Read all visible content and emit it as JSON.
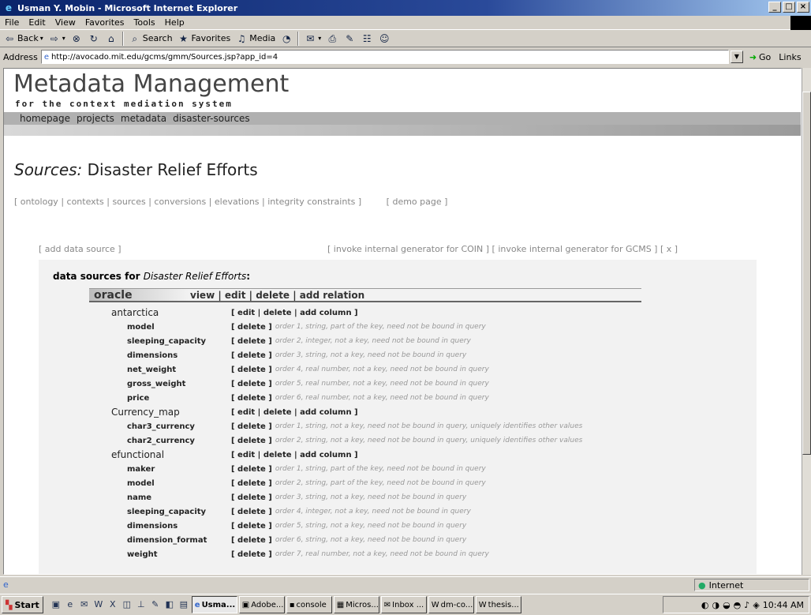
{
  "window": {
    "title": "Usman Y. Mobin - Microsoft Internet Explorer",
    "buttons": [
      "_",
      "×"
    ]
  },
  "menu": [
    "File",
    "Edit",
    "View",
    "Favorites",
    "Tools",
    "Help"
  ],
  "toolbar": {
    "back": "Back",
    "search": "Search",
    "favorites": "Favorites",
    "media": "Media"
  },
  "address": {
    "label": "Address",
    "url": "http://avocado.mit.edu/gcms/gmm/Sources.jsp?app_id=4",
    "go": "Go",
    "links": "Links"
  },
  "site": {
    "logo": "Metadata Management",
    "tagline": "for the context mediation system",
    "nav": [
      "homepage",
      "projects",
      "metadata",
      "disaster-sources"
    ]
  },
  "page": {
    "title_italic": "Sources:",
    "title_rest": "Disaster Relief Efforts",
    "crumbs": [
      "ontology",
      "contexts",
      "sources",
      "conversions",
      "elevations",
      "integrity constraints"
    ],
    "demo": "demo page",
    "add_source": "add data source",
    "invoke_coin": "invoke internal generator for COIN",
    "invoke_gcms": "invoke internal generator for GCMS",
    "x": "x",
    "panel_heading": "data sources for",
    "panel_heading_italic": "Disaster Relief Efforts",
    "panel_heading_colon": ":",
    "source_name": "oracle",
    "source_ops": "view | edit | delete | add relation"
  },
  "rows": [
    {
      "type": "table",
      "name": "antarctica",
      "ops": "[ edit | delete | add column ]"
    },
    {
      "type": "col",
      "name": "model",
      "ops": "[ delete ]",
      "desc": "order 1, string, part of the key, need not be bound in query"
    },
    {
      "type": "col",
      "name": "sleeping_capacity",
      "ops": "[ delete ]",
      "desc": "order 2, integer, not a key, need not be bound in query"
    },
    {
      "type": "col",
      "name": "dimensions",
      "ops": "[ delete ]",
      "desc": "order 3, string, not a key, need not be bound in query"
    },
    {
      "type": "col",
      "name": "net_weight",
      "ops": "[ delete ]",
      "desc": "order 4, real number, not a key, need not be bound in query"
    },
    {
      "type": "col",
      "name": "gross_weight",
      "ops": "[ delete ]",
      "desc": "order 5, real number, not a key, need not be bound in query"
    },
    {
      "type": "col",
      "name": "price",
      "ops": "[ delete ]",
      "desc": "order 6, real number, not a key, need not be bound in query"
    },
    {
      "type": "table",
      "name": "Currency_map",
      "ops": "[ edit | delete | add column ]"
    },
    {
      "type": "col",
      "name": "char3_currency",
      "ops": "[ delete ]",
      "desc": "order 1, string, not a key, need not be bound in query, uniquely identifies other values"
    },
    {
      "type": "col",
      "name": "char2_currency",
      "ops": "[ delete ]",
      "desc": "order 2, string, not a key, need not be bound in query, uniquely identifies other values"
    },
    {
      "type": "table",
      "name": "efunctional",
      "ops": "[ edit | delete | add column ]"
    },
    {
      "type": "col",
      "name": "maker",
      "ops": "[ delete ]",
      "desc": "order 1, string, part of the key, need not be bound in query"
    },
    {
      "type": "col",
      "name": "model",
      "ops": "[ delete ]",
      "desc": "order 2, string, part of the key, need not be bound in query"
    },
    {
      "type": "col",
      "name": "name",
      "ops": "[ delete ]",
      "desc": "order 3, string, not a key, need not be bound in query"
    },
    {
      "type": "col",
      "name": "sleeping_capacity",
      "ops": "[ delete ]",
      "desc": "order 4, integer, not a key, need not be bound in query"
    },
    {
      "type": "col",
      "name": "dimensions",
      "ops": "[ delete ]",
      "desc": "order 5, string, not a key, need not be bound in query"
    },
    {
      "type": "col",
      "name": "dimension_format",
      "ops": "[ delete ]",
      "desc": "order 6, string, not a key, need not be bound in query"
    },
    {
      "type": "col",
      "name": "weight",
      "ops": "[ delete ]",
      "desc": "order 7, real number, not a key, need not be bound in query"
    }
  ],
  "status": {
    "zone": "Internet"
  },
  "taskbar": {
    "start": "Start",
    "tasks": [
      "Usma...",
      "Adobe...",
      "console",
      "Micros...",
      "Inbox ...",
      "dm-co...",
      "thesis..."
    ],
    "clock": "10:44 AM"
  }
}
